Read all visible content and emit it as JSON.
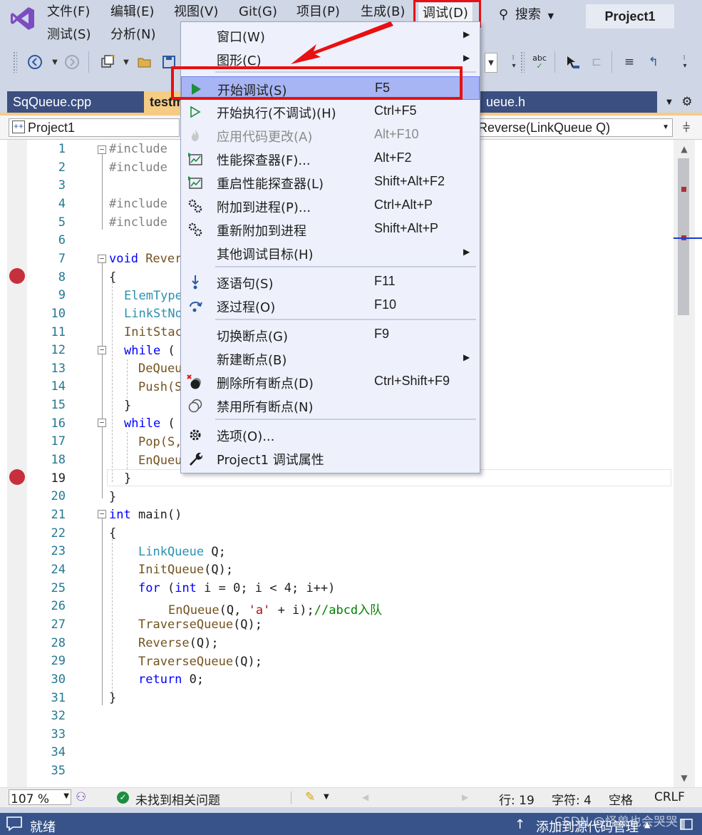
{
  "menubar": {
    "row1": [
      "文件(F)",
      "编辑(E)",
      "视图(V)",
      "Git(G)",
      "项目(P)",
      "生成(B)",
      "调试(D)"
    ],
    "row2": [
      "测试(S)",
      "分析(N)"
    ],
    "search_label": "搜索",
    "project_name": "Project1"
  },
  "tabs": [
    {
      "label": "SqQueue.cpp",
      "active": false
    },
    {
      "label": "testm",
      "active": true
    },
    {
      "label": "ueue.h",
      "active": false
    }
  ],
  "navbar": {
    "project": "Project1",
    "member": "Reverse(LinkQueue Q)"
  },
  "editor": {
    "line_numbers": [
      "1",
      "2",
      "3",
      "4",
      "5",
      "6",
      "7",
      "8",
      "9",
      "10",
      "11",
      "12",
      "13",
      "14",
      "15",
      "16",
      "17",
      "18",
      "19",
      "20",
      "21",
      "22",
      "23",
      "24",
      "25",
      "26",
      "27",
      "28",
      "29",
      "30",
      "31",
      "32",
      "33",
      "34",
      "35"
    ],
    "breakpoint_lines": [
      8,
      19
    ],
    "current_line": 19,
    "lines": {
      "l1": "#include",
      "l2": "#include",
      "l4": "#include",
      "l5": "#include",
      "l7a": "void",
      "l7b": " Rever",
      "l8": "{",
      "l9": "ElemType",
      "l10": "LinkStNo",
      "l11": "InitStac",
      "l12a": "while",
      "l12b": " (",
      "l13": "DeQueu",
      "l14": "Push(S",
      "l15": "}",
      "l16a": "while",
      "l16b": " (",
      "l17": "Pop(S,",
      "l18": "EnQueu",
      "l19": "}",
      "l20": "}",
      "l21a": "int",
      "l21b": " main()",
      "l22": "{",
      "l23a": "LinkQueue",
      "l23b": " Q;",
      "l24a": "InitQueue",
      "l24b": "(Q);",
      "l25a": "for",
      "l25b": " (",
      "l25c": "int",
      "l25d": " i = 0; i < 4; i++)",
      "l26a": "EnQueue",
      "l26b": "(Q, ",
      "l26c": "'a'",
      "l26d": " + i);",
      "l26e": "//abcd入队",
      "l27a": "TraverseQueue",
      "l27b": "(Q);",
      "l28a": "Reverse",
      "l28b": "(Q);",
      "l29a": "TraverseQueue",
      "l29b": "(Q);",
      "l30a": "return",
      "l30b": " 0;",
      "l31": "}"
    }
  },
  "debug_menu": {
    "items": [
      {
        "label": "窗口(W)",
        "shortcut": "",
        "icon": "",
        "submenu": true
      },
      {
        "label": "图形(C)",
        "shortcut": "",
        "icon": "",
        "submenu": true
      },
      {
        "label": "开始调试(S)",
        "shortcut": "F5",
        "icon": "play-icon",
        "highlighted": true
      },
      {
        "label": "开始执行(不调试)(H)",
        "shortcut": "Ctrl+F5",
        "icon": "play-outline-icon"
      },
      {
        "label": "应用代码更改(A)",
        "shortcut": "Alt+F10",
        "icon": "flame-icon",
        "disabled": true
      },
      {
        "label": "性能探查器(F)...",
        "shortcut": "Alt+F2",
        "icon": "profiler-icon"
      },
      {
        "label": "重启性能探查器(L)",
        "shortcut": "Shift+Alt+F2",
        "icon": "profiler-icon"
      },
      {
        "label": "附加到进程(P)...",
        "shortcut": "Ctrl+Alt+P",
        "icon": "gears-icon"
      },
      {
        "label": "重新附加到进程",
        "shortcut": "Shift+Alt+P",
        "icon": "gears-icon"
      },
      {
        "label": "其他调试目标(H)",
        "shortcut": "",
        "icon": "",
        "submenu": true
      },
      {
        "label": "逐语句(S)",
        "shortcut": "F11",
        "icon": "step-into-icon"
      },
      {
        "label": "逐过程(O)",
        "shortcut": "F10",
        "icon": "step-over-icon"
      },
      {
        "label": "切换断点(G)",
        "shortcut": "F9",
        "icon": ""
      },
      {
        "label": "新建断点(B)",
        "shortcut": "",
        "icon": "",
        "submenu": true
      },
      {
        "label": "删除所有断点(D)",
        "shortcut": "Ctrl+Shift+F9",
        "icon": "delete-breakpoints-icon"
      },
      {
        "label": "禁用所有断点(N)",
        "shortcut": "",
        "icon": "disable-breakpoints-icon"
      },
      {
        "label": "选项(O)...",
        "shortcut": "",
        "icon": "gear-icon"
      },
      {
        "label": "Project1 调试属性",
        "shortcut": "",
        "icon": "wrench-icon"
      }
    ]
  },
  "editor_status": {
    "zoom": "107 %",
    "issues": "未找到相关问题",
    "line": "行: 19",
    "char": "字符: 4",
    "spaces": "空格",
    "eol": "CRLF"
  },
  "statusbar": {
    "ready": "就绪",
    "source_control": "添加到源代码管理",
    "watermark": "CSDN @怪兽也会哭哭"
  },
  "colors": {
    "accent_tab": "#f5cc84",
    "status_bar": "#37538a",
    "highlight": "#a7b5f5",
    "breakpoint": "#c5303c",
    "annotation": "#e81010"
  }
}
